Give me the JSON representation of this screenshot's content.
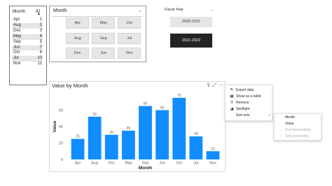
{
  "table": {
    "headers": [
      "Month",
      "ID"
    ],
    "sort_indicator": "▲",
    "rows": [
      {
        "month": "Apr",
        "id": "1"
      },
      {
        "month": "Aug",
        "id": "2"
      },
      {
        "month": "Dec",
        "id": "3"
      },
      {
        "month": "May",
        "id": "4"
      },
      {
        "month": "Sep",
        "id": "5"
      },
      {
        "month": "Jun",
        "id": "7"
      },
      {
        "month": "Oct",
        "id": "8"
      },
      {
        "month": "Jul",
        "id": "10"
      },
      {
        "month": "Nov",
        "id": "11"
      }
    ]
  },
  "month_slicer": {
    "title": "Month",
    "chevron": "⌄",
    "tiles": [
      "Apr",
      "May",
      "Oct",
      "Aug",
      "Sep",
      "Jul",
      "Dec",
      "Jun",
      "Nov"
    ]
  },
  "fiscal_year_slicer": {
    "title": "Fiscal Year",
    "chevron": "⌄",
    "options": [
      {
        "label": "2020-2021",
        "selected": false
      },
      {
        "label": "2021-2022",
        "selected": true
      }
    ]
  },
  "chart_toolbar": {
    "filter_icon": "filter-icon",
    "focus_icon": "focus-mode-icon",
    "more_icon": "more-options-icon"
  },
  "chart_data": {
    "type": "bar",
    "title": "Value by Month",
    "xlabel": "Month",
    "ylabel": "Value",
    "categories": [
      "Apr",
      "Aug",
      "Dec",
      "May",
      "Sep",
      "Jun",
      "Oct",
      "Jul",
      "Nov"
    ],
    "values": [
      25,
      52,
      30,
      35,
      65,
      60,
      75,
      28,
      10
    ],
    "ylim": [
      0,
      80
    ],
    "yticks": [
      0,
      20,
      40,
      60
    ],
    "grid": false,
    "bar_color": "#118dff",
    "data_labels": true
  },
  "context_menu": {
    "items": [
      {
        "icon": "export-icon",
        "glyph": "⇱",
        "label": "Export data"
      },
      {
        "icon": "table-icon",
        "glyph": "▦",
        "label": "Show as a table"
      },
      {
        "icon": "remove-icon",
        "glyph": "✕",
        "label": "Remove"
      },
      {
        "icon": "spotlight-icon",
        "glyph": "◪",
        "label": "Spotlight"
      },
      {
        "icon": "sort-icon",
        "glyph": "",
        "label": "Sort axis",
        "arrow": "›"
      }
    ]
  },
  "sort_submenu": {
    "items": [
      {
        "label": "Month",
        "enabled": true,
        "glyph": ""
      },
      {
        "label": "Value",
        "enabled": true,
        "glyph": ""
      },
      {
        "label": "Sort descending",
        "enabled": false,
        "glyph": "↓"
      },
      {
        "label": "Sort ascending",
        "enabled": false,
        "glyph": "↑"
      }
    ]
  }
}
